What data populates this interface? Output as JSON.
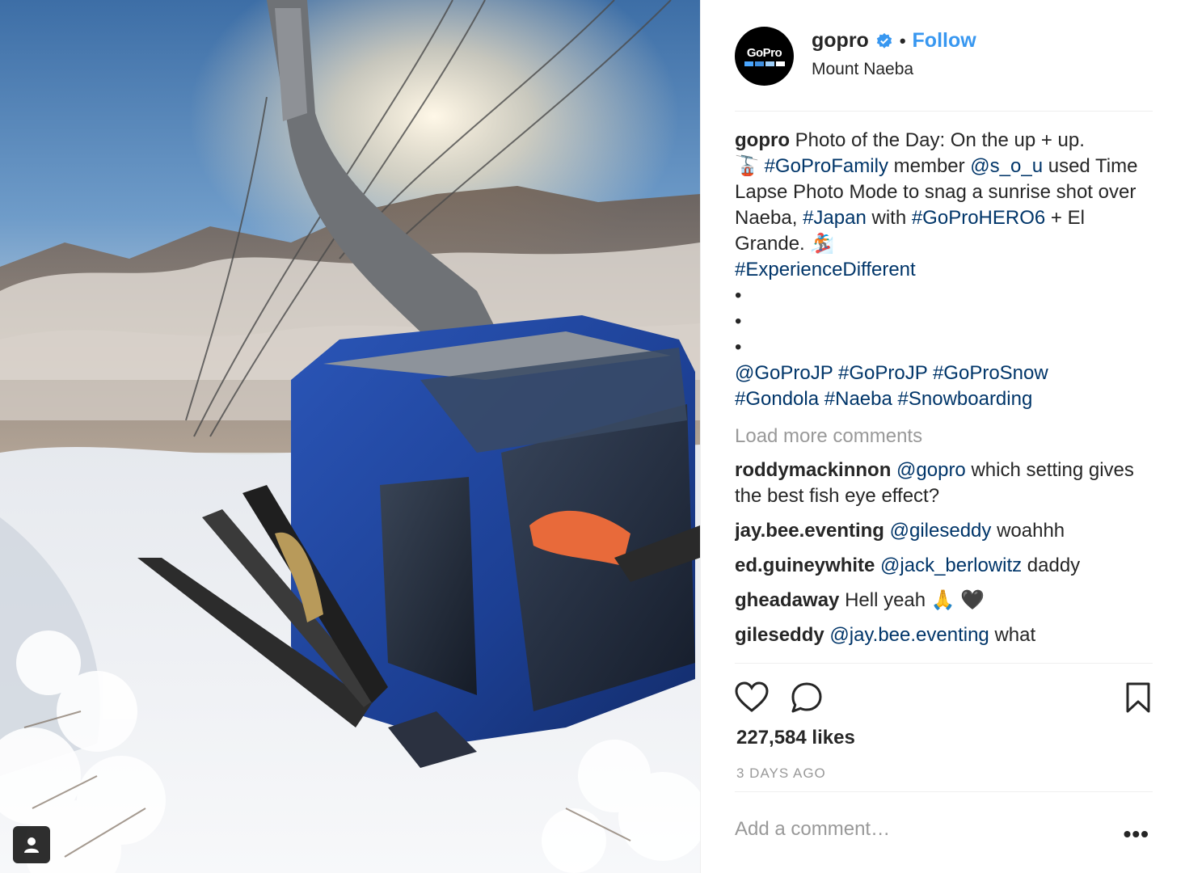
{
  "header": {
    "username": "gopro",
    "follow_label": "Follow",
    "location": "Mount Naeba",
    "avatar_text": "GoPro",
    "verified_icon": "verified-badge-icon",
    "separator": "•"
  },
  "caption": {
    "username": "gopro",
    "line1": "Photo of the Day: On the up + up.",
    "emoji1": "🚡",
    "tag1": "#GoProFamily",
    "t2": " member ",
    "mention1": "@s_o_u",
    "t3": " used Time Lapse Photo Mode to snag a sunrise shot over Naeba, ",
    "tag2": "#Japan",
    "t4": " with ",
    "tag3": "#GoProHERO6",
    "t5": " + El Grande. ",
    "emoji2": "🏂",
    "tag4": "#ExperienceDifferent",
    "bullet": "•",
    "tags_line": [
      "@GoProJP",
      "#GoProJP",
      "#GoProSnow",
      "#Gondola",
      "#Naeba",
      "#Snowboarding"
    ]
  },
  "load_more": "Load more comments",
  "comments": [
    {
      "user": "roddymackinnon",
      "mention": "@gopro",
      "text": " which setting gives the best fish eye effect?"
    },
    {
      "user": "jay.bee.eventing",
      "mention": "@gileseddy",
      "text": " woahhh"
    },
    {
      "user": "ed.guineywhite",
      "mention": "@jack_berlowitz",
      "text": " daddy"
    },
    {
      "user": "gheadaway",
      "mention": "",
      "text": "Hell yeah 🙏 🖤"
    },
    {
      "user": "gileseddy",
      "mention": "@jay.bee.eventing",
      "text": " what"
    }
  ],
  "likes": "227,584 likes",
  "posted": "3 DAYS AGO",
  "add_comment_placeholder": "Add a comment…",
  "more_label": "•••",
  "colors": {
    "link": "#003569",
    "follow": "#3897f0",
    "muted": "#999999"
  }
}
